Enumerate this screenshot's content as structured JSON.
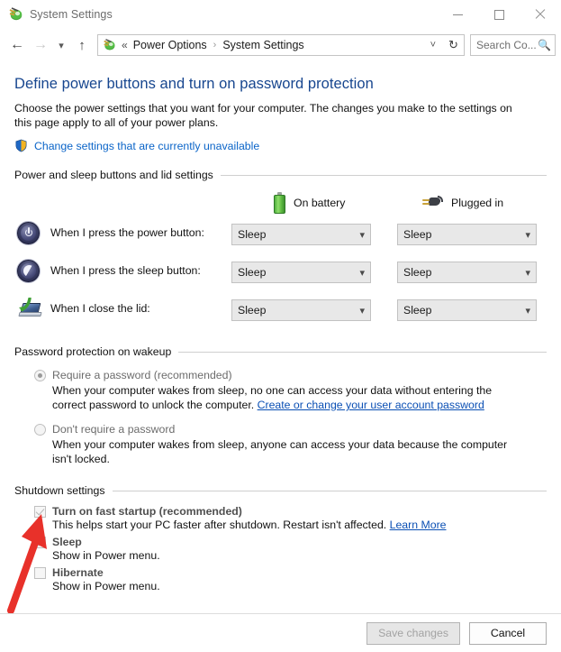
{
  "window": {
    "title": "System Settings",
    "app_icon": "power-plug-icon",
    "controls": {
      "minimize": "minimize-icon",
      "maximize": "maximize-icon",
      "close": "close-icon"
    }
  },
  "nav": {
    "back": "back-arrow-icon",
    "forward": "forward-arrow-icon",
    "recent": "chevron-down-icon",
    "up": "up-arrow-icon",
    "refresh": "refresh-icon",
    "address_icon": "power-plug-icon",
    "double_chevron": "«",
    "breadcrumbs": [
      "Power Options",
      "System Settings"
    ],
    "separator": "›",
    "dropdown_chevron": "˅",
    "search": {
      "placeholder": "Search Co...",
      "icon": "search-icon"
    }
  },
  "page": {
    "title": "Define power buttons and turn on password protection",
    "description": "Choose the power settings that you want for your computer. The changes you make to the settings on this page apply to all of your power plans.",
    "uac_link": "Change settings that are currently unavailable",
    "uac_icon": "shield-icon"
  },
  "power_section": {
    "heading": "Power and sleep buttons and lid settings",
    "columns": [
      {
        "label": "On battery",
        "icon": "battery-icon"
      },
      {
        "label": "Plugged in",
        "icon": "plug-icon"
      }
    ],
    "rows": [
      {
        "icon": "power-button-icon",
        "label": "When I press the power button:",
        "on_battery": "Sleep",
        "plugged_in": "Sleep"
      },
      {
        "icon": "sleep-button-icon",
        "label": "When I press the sleep button:",
        "on_battery": "Sleep",
        "plugged_in": "Sleep"
      },
      {
        "icon": "laptop-lid-icon",
        "label": "When I close the lid:",
        "on_battery": "Sleep",
        "plugged_in": "Sleep"
      }
    ]
  },
  "password_section": {
    "heading": "Password protection on wakeup",
    "options": [
      {
        "label": "Require a password (recommended)",
        "selected": true,
        "description_before": "When your computer wakes from sleep, no one can access your data without entering the correct password to unlock the computer. ",
        "link": "Create or change your user account password"
      },
      {
        "label": "Don't require a password",
        "selected": false,
        "description_before": "When your computer wakes from sleep, anyone can access your data because the computer isn't locked.",
        "link": ""
      }
    ]
  },
  "shutdown_section": {
    "heading": "Shutdown settings",
    "items": [
      {
        "label": "Turn on fast startup (recommended)",
        "checked": true,
        "description_before": "This helps start your PC faster after shutdown. Restart isn't affected. ",
        "link": "Learn More"
      },
      {
        "label": "Sleep",
        "checked": true,
        "description_before": "Show in Power menu.",
        "link": ""
      },
      {
        "label": "Hibernate",
        "checked": false,
        "description_before": "Show in Power menu.",
        "link": ""
      }
    ]
  },
  "footer": {
    "save_label": "Save changes",
    "save_enabled": false,
    "cancel_label": "Cancel",
    "cancel_enabled": true
  },
  "annotation": {
    "type": "red-arrow",
    "color": "#e8312a",
    "points_at": "fast-startup-checkbox"
  }
}
